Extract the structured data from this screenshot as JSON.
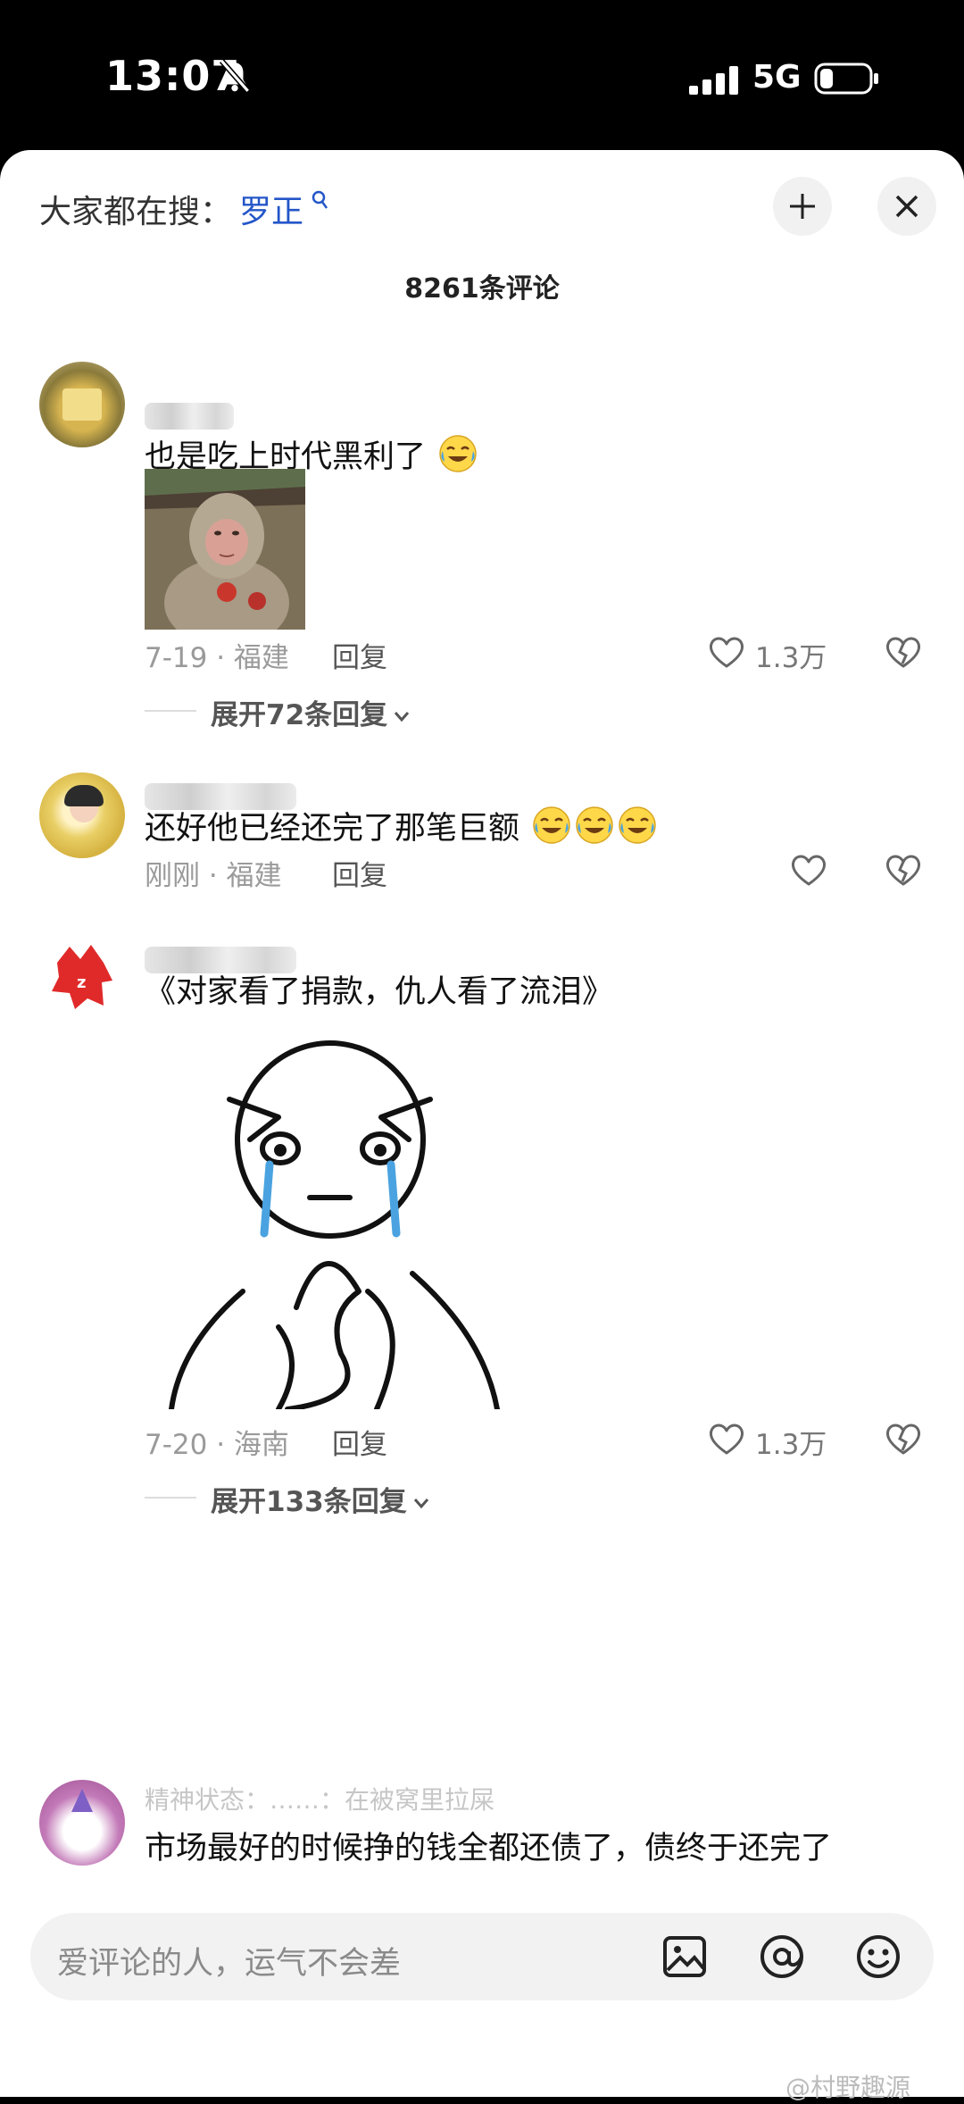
{
  "status_bar": {
    "time": "13:07",
    "network": "5G"
  },
  "header": {
    "search_prefix": "大家都在搜：",
    "search_term": "罗正",
    "comment_count": "8261条评论"
  },
  "comments": [
    {
      "text": "也是吃上时代黑利了",
      "date_location": "7-19 · 福建",
      "reply_label": "回复",
      "likes": "1.3万",
      "expand_label": "展开72条回复"
    },
    {
      "text": "还好他已经还完了那笔巨额",
      "date_location": "刚刚 · 福建",
      "reply_label": "回复"
    },
    {
      "text": "《对家看了捐款，仇人看了流泪》",
      "date_location": "7-20 · 海南",
      "reply_label": "回复",
      "likes": "1.3万",
      "expand_label": "展开133条回复"
    },
    {
      "username": "精神状态：……：在被窝里拉屎",
      "text": "市场最好的时候挣的钱全都还债了，债终于还完了"
    }
  ],
  "input": {
    "placeholder": "爱评论的人，运气不会差"
  },
  "watermark": "@村野趣源",
  "icons": [
    "mute-bell-icon",
    "signal-icon",
    "battery-icon",
    "search-icon",
    "plus-icon",
    "close-icon",
    "heart-icon",
    "broken-heart-icon",
    "chevron-down-icon",
    "image-icon",
    "at-icon",
    "emoji-icon"
  ],
  "colors": {
    "accent_link": "#2456c8",
    "tear_blue": "#4aa3e0"
  }
}
